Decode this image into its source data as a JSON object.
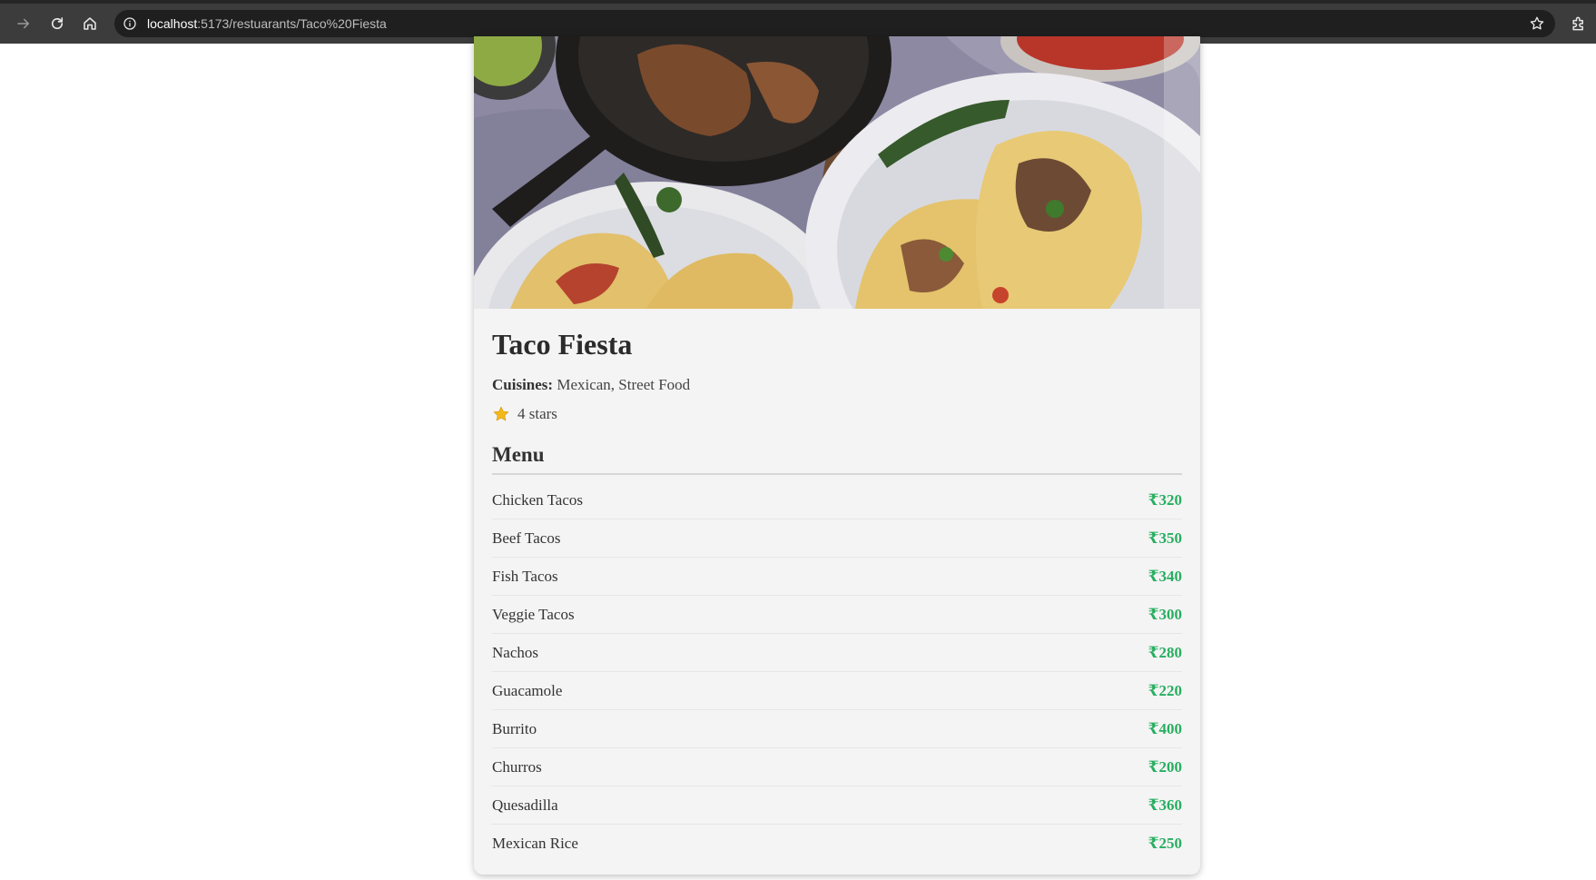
{
  "browser": {
    "url_host": "localhost",
    "url_rest": ":5173/restuarants/Taco%20Fiesta",
    "icons": [
      "forward-icon",
      "reload-icon",
      "home-icon",
      "site-info-icon",
      "bookmark-star-icon",
      "extensions-icon"
    ]
  },
  "restaurant": {
    "name": "Taco Fiesta",
    "cuisines_label": "Cuisines:",
    "cuisines_value": " Mexican, Street Food",
    "rating_text": "4 stars",
    "rating_value": 4,
    "menu_heading": "Menu",
    "menu": [
      {
        "name": "Chicken Tacos",
        "price": "₹320"
      },
      {
        "name": "Beef Tacos",
        "price": "₹350"
      },
      {
        "name": "Fish Tacos",
        "price": "₹340"
      },
      {
        "name": "Veggie Tacos",
        "price": "₹300"
      },
      {
        "name": "Nachos",
        "price": "₹280"
      },
      {
        "name": "Guacamole",
        "price": "₹220"
      },
      {
        "name": "Burrito",
        "price": "₹400"
      },
      {
        "name": "Churros",
        "price": "₹200"
      },
      {
        "name": "Quesadilla",
        "price": "₹360"
      },
      {
        "name": "Mexican Rice",
        "price": "₹250"
      }
    ]
  },
  "colors": {
    "price": "#27ae60",
    "card_bg": "#f4f4f4",
    "chrome_bg": "#3c3c3c",
    "star": "#f2b91a"
  }
}
